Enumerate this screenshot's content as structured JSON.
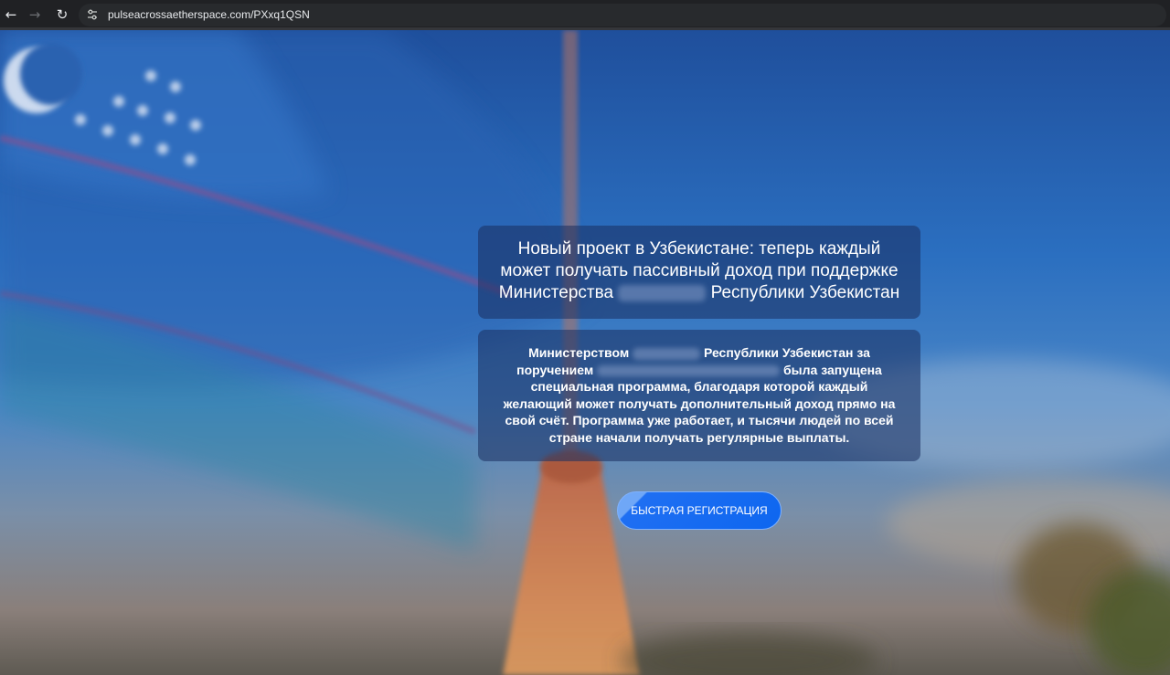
{
  "browser": {
    "url": "pulseacrossaetherspace.com/PXxq1QSN"
  },
  "hero": {
    "title_part1": "Новый проект в Узбекистане: теперь каждый может получать пассивный доход при поддержке Министерства",
    "title_part2": "Республики Узбекистан",
    "body_part1": "Министерством",
    "body_part2": "Республики Узбекистан за поручением",
    "body_part3": "была запущена специальная программа, благодаря которой каждый желающий может получать дополнительный доход прямо на свой счёт. Программа уже работает, и тысячи людей по всей стране начали получать регулярные выплаты.",
    "cta_label": "БЫСТРАЯ РЕГИСТРАЦИЯ"
  },
  "colors": {
    "cta": "#0d66f0",
    "card_bg": "#192d5f",
    "browser_bar": "#202124"
  },
  "icons": {
    "back": "arrow-left-icon",
    "forward": "arrow-right-icon",
    "reload": "reload-icon",
    "site_info": "tune-icon"
  }
}
